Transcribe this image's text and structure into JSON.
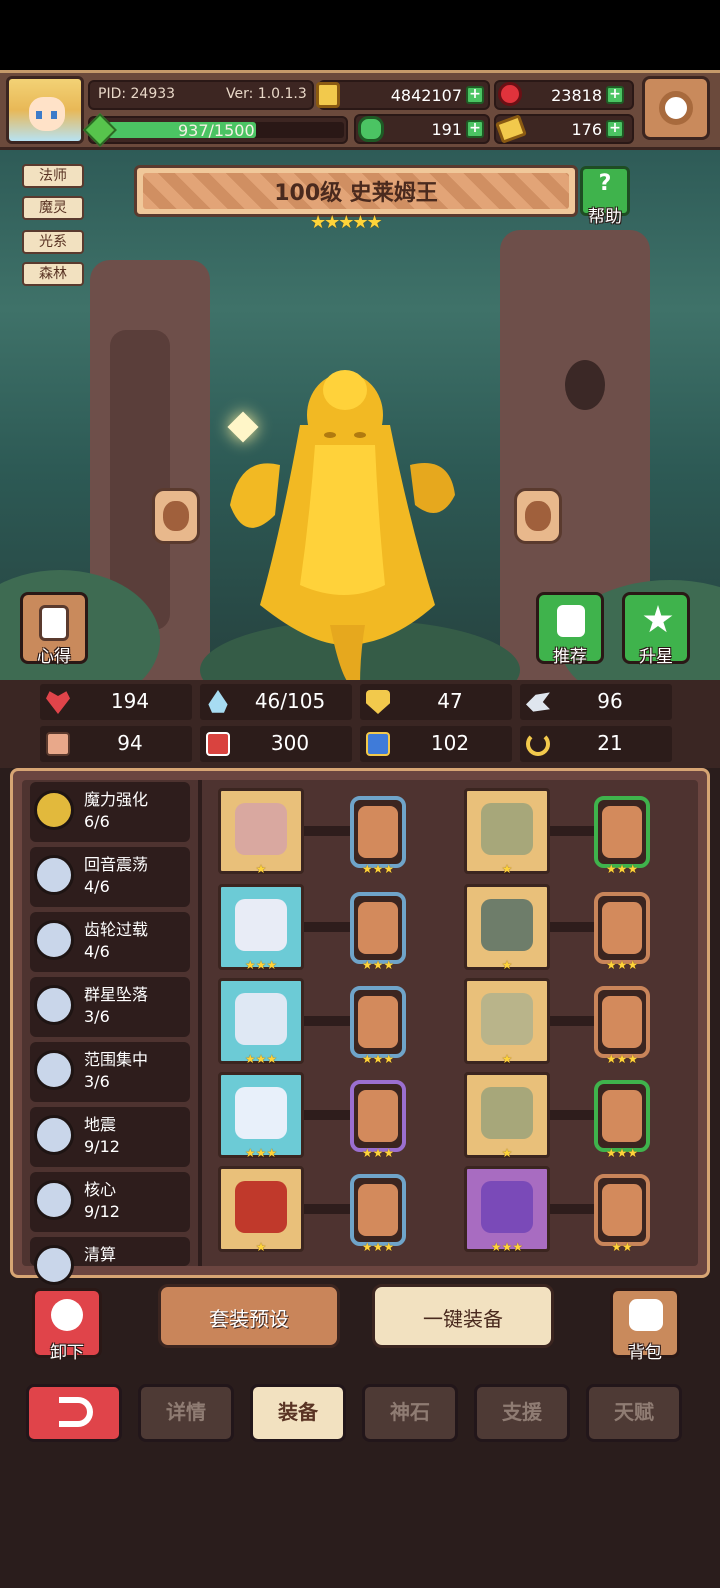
{
  "header": {
    "pid": "PID: 24933",
    "version": "Ver: 1.0.1.3",
    "exp_text": "937/1500",
    "exp_fraction": 0.625,
    "gold": "4842107",
    "gems": "23818",
    "clover": "191",
    "tickets": "176"
  },
  "tags": [
    "法师",
    "魔灵",
    "光系",
    "森林"
  ],
  "character": {
    "title": "100级  史莱姆王",
    "stars": "★★★★★",
    "help_label": "帮助",
    "notes_label": "心得",
    "recommend_label": "推荐",
    "upgrade_label": "升星"
  },
  "stats": {
    "hp": "194",
    "mana": "46/105",
    "defense": "47",
    "speed": "96",
    "attack": "94",
    "magic": "300",
    "resist": "102",
    "crit": "21"
  },
  "skills": [
    {
      "name": "魔力强化",
      "count": "6/6"
    },
    {
      "name": "回音震荡",
      "count": "4/6"
    },
    {
      "name": "齿轮过载",
      "count": "4/6"
    },
    {
      "name": "群星坠落",
      "count": "3/6"
    },
    {
      "name": "范围集中",
      "count": "3/6"
    },
    {
      "name": "地震",
      "count": "9/12"
    },
    {
      "name": "核心",
      "count": "9/12"
    },
    {
      "name": "清算",
      "count": ""
    }
  ],
  "equipment": {
    "left_stars": [
      "★",
      "★★★",
      "★★★",
      "★★★",
      "★"
    ],
    "left_rune_stars": [
      "★★★",
      "★★★",
      "★★★",
      "★★★",
      "★★★"
    ],
    "right_stars": [
      "★",
      "★",
      "★",
      "★",
      "★★★"
    ],
    "right_rune_stars": [
      "★★★",
      "★★★",
      "★★★",
      "★★★",
      "★★"
    ]
  },
  "actions": {
    "unequip": "卸下",
    "preset": "套装预设",
    "auto_equip": "一键装备",
    "backpack": "背包"
  },
  "tabs": [
    "详情",
    "装备",
    "神石",
    "支援",
    "天赋"
  ],
  "colors": {
    "active_tab": "#f2e1c0",
    "accent_green": "#4bc463",
    "back_red": "#e0444a"
  }
}
